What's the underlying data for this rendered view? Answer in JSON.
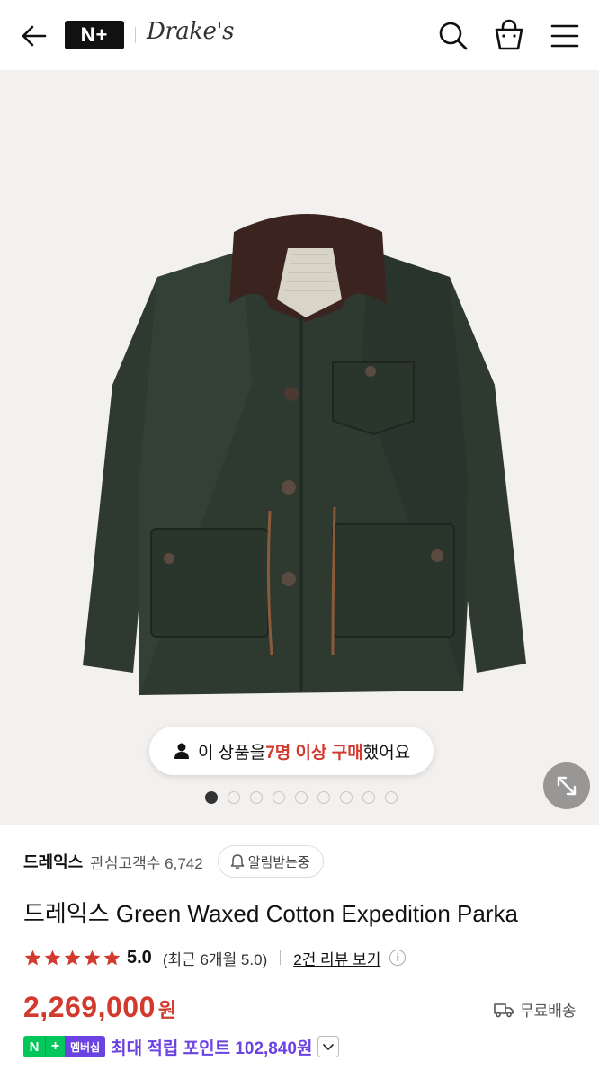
{
  "header": {
    "logo_label": "N+",
    "brand_logo_text": "Drake's"
  },
  "hero": {
    "buy_notice": {
      "prefix": "이 상품을 ",
      "highlight": "7명 이상 구매",
      "suffix": " 했어요"
    },
    "slide_count": 9,
    "active_slide": 1
  },
  "product": {
    "brand": "드레익스",
    "fans_label": "관심고객수 6,742",
    "notify_label": "알림받는중",
    "title": "드레익스 Green Waxed Cotton Expedition Parka",
    "rating": "5.0",
    "recent_rating": "(최근 6개월 5.0)",
    "review_link": "2건 리뷰 보기",
    "price": "2,269,000",
    "currency": "원",
    "shipping": "무료배송",
    "membership": {
      "badge_n": "N",
      "badge_plus": "+",
      "badge_text": "멤버십",
      "points": "최대 적립 포인트 102,840원"
    }
  },
  "colors": {
    "accent_red": "#d23a2e",
    "member_purple": "#6b43e3",
    "naver_green": "#03c75a",
    "star_color": "#d23a2e"
  }
}
